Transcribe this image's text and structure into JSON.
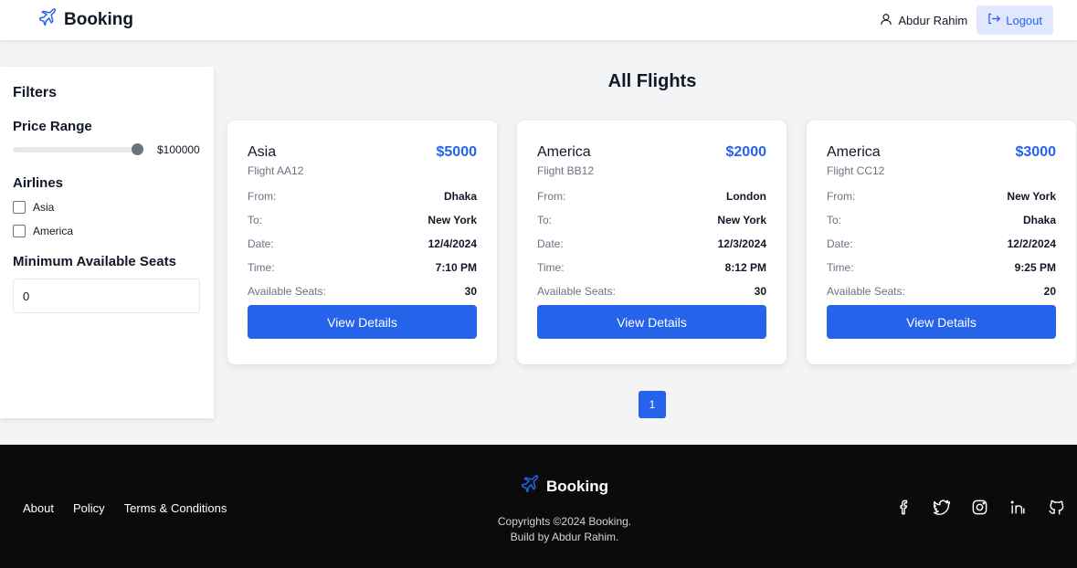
{
  "navbar": {
    "brand": "Booking",
    "user_name": "Abdur Rahim",
    "logout_label": "Logout"
  },
  "colors": {
    "primary": "#2563eb",
    "logout_bg": "#e0e7ff",
    "footer_bg": "#0b0b0b"
  },
  "filters": {
    "title": "Filters",
    "price_range_label": "Price Range",
    "price_value": "$100000",
    "price_slider_fraction": 1.0,
    "airlines_label": "Airlines",
    "airlines": [
      {
        "label": "Asia",
        "checked": false
      },
      {
        "label": "America",
        "checked": false
      }
    ],
    "seats_label": "Minimum Available Seats",
    "seats_value": "0"
  },
  "main": {
    "title": "All Flights",
    "labels": {
      "from": "From:",
      "to": "To:",
      "date": "Date:",
      "time": "Time:",
      "seats": "Available Seats:"
    },
    "details_label": "View Details",
    "flights": [
      {
        "airline": "Asia",
        "price": "$5000",
        "flight_no": "Flight AA12",
        "from": "Dhaka",
        "to": "New York",
        "date": "12/4/2024",
        "time": "7:10 PM",
        "seats": "30"
      },
      {
        "airline": "America",
        "price": "$2000",
        "flight_no": "Flight BB12",
        "from": "London",
        "to": "New York",
        "date": "12/3/2024",
        "time": "8:12 PM",
        "seats": "30"
      },
      {
        "airline": "America",
        "price": "$3000",
        "flight_no": "Flight CC12",
        "from": "New York",
        "to": "Dhaka",
        "date": "12/2/2024",
        "time": "9:25 PM",
        "seats": "20"
      }
    ],
    "page": "1"
  },
  "footer": {
    "links": [
      "About",
      "Policy",
      "Terms & Conditions"
    ],
    "brand": "Booking",
    "copyright": "Copyrights ©2024 Booking.",
    "built_by": "Build by Abdur Rahim.",
    "socials": [
      "facebook-icon",
      "twitter-icon",
      "instagram-icon",
      "linkedin-icon",
      "github-icon"
    ]
  }
}
